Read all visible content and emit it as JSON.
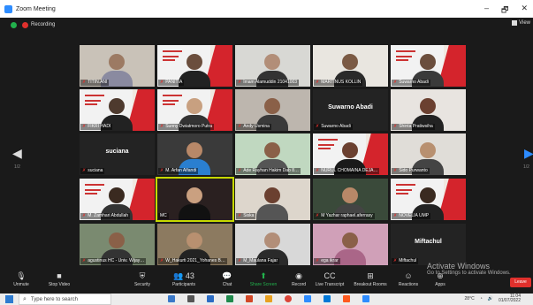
{
  "window": {
    "title": "Zoom Meeting",
    "controls": [
      "–",
      "🗗",
      "✕"
    ]
  },
  "topbar": {
    "recording_label": "Recording",
    "view_label": "View"
  },
  "pager": {
    "left": "1/2",
    "right": "1/2"
  },
  "tiles": [
    {
      "name": "TITIN.ANI",
      "kind": "person",
      "bg": "#c9c2b8",
      "skin": "#9c7a63",
      "cloth": "#8a8aa0",
      "muted": true
    },
    {
      "name": "PANITIA",
      "kind": "slide-person",
      "bg": "#f0e8e0",
      "skin": "#6b4e3d",
      "cloth": "#222",
      "muted": true
    },
    {
      "name": "Imam Alamuddin 21041003",
      "kind": "person",
      "bg": "#d8d8d4",
      "skin": "#b28e78",
      "cloth": "#333",
      "muted": true
    },
    {
      "name": "MARTINUS KOLLIN",
      "kind": "person",
      "bg": "#e9e6e0",
      "skin": "#7b5a44",
      "cloth": "#2a2a2a",
      "muted": true
    },
    {
      "name": "Suwarno Abadi",
      "kind": "slide-person",
      "bg": "#f0e8e0",
      "skin": "#6b4e3d",
      "cloth": "#3a3a3a",
      "muted": true
    },
    {
      "name": "FIKRI HADI",
      "kind": "slide-person",
      "bg": "#f0e8e0",
      "skin": "#4e3a2e",
      "cloth": "#222",
      "muted": true
    },
    {
      "name": "Sunny Dwiatmoro Putra",
      "kind": "slide-person",
      "bg": "#f0e8e0",
      "skin": "#c8a080",
      "cloth": "#333",
      "muted": true
    },
    {
      "name": "Andy Usmina",
      "kind": "person",
      "bg": "#bdb6ae",
      "skin": "#8a6048",
      "cloth": "#3a3a3a",
      "muted": true
    },
    {
      "name": "Suwarno Abadi",
      "kind": "name",
      "big": "Suwarno Abadi",
      "bg": "#232323",
      "muted": true
    },
    {
      "name": "Shinta Pratiwsiha",
      "kind": "person",
      "bg": "#e8e4e0",
      "skin": "#6b4030",
      "cloth": "#222",
      "muted": true
    },
    {
      "name": "suciana",
      "kind": "name",
      "big": "suciana",
      "bg": "#232323",
      "muted": true
    },
    {
      "name": "M. Arfan Alfandi",
      "kind": "person",
      "bg": "#3a3a3a",
      "skin": "#b88868",
      "cloth": "#2a7fd0",
      "muted": true
    },
    {
      "name": "Ade Rayhan Hakim Dab 8…",
      "kind": "person",
      "bg": "#c0d8c0",
      "skin": "#8a6048",
      "cloth": "#555",
      "muted": true
    },
    {
      "name": "NURUL CHOMAINA DEJA…",
      "kind": "slide-person",
      "bg": "#f0e8e0",
      "skin": "#6b4030",
      "cloth": "#1a1a1a",
      "muted": true
    },
    {
      "name": "Sido Purwanto",
      "kind": "person",
      "bg": "#e0ddd8",
      "skin": "#b89070",
      "cloth": "#444",
      "muted": true
    },
    {
      "name": "M. Zamhari Abdullah",
      "kind": "slide-person",
      "bg": "#f0e8e0",
      "skin": "#3a2a20",
      "cloth": "#333",
      "muted": true
    },
    {
      "name": "MC",
      "kind": "person",
      "bg": "#2a2020",
      "skin": "#caa080",
      "cloth": "#111",
      "muted": false,
      "speaking": true
    },
    {
      "name": "Siska",
      "kind": "person",
      "bg": "#ddd6cc",
      "skin": "#6b4030",
      "cloth": "#555",
      "muted": true
    },
    {
      "name": "M Yazhar raphael.aferrasy",
      "kind": "person",
      "bg": "#3a4a3a",
      "skin": "#b88868",
      "cloth": "#444",
      "muted": true
    },
    {
      "name": "NOVELIA UMP",
      "kind": "slide-person",
      "bg": "#f0e8e0",
      "skin": "#3a2a20",
      "cloth": "#222",
      "muted": true
    },
    {
      "name": "agustinus HC - Univ. Wijay…",
      "kind": "person",
      "bg": "#7a8a70",
      "skin": "#8a6048",
      "cloth": "#333",
      "muted": true
    },
    {
      "name": "W_Hakurti 2021_Yohanes B…",
      "kind": "person",
      "bg": "#8c7a60",
      "skin": "#b89070",
      "cloth": "#222",
      "muted": true
    },
    {
      "name": "M_Maulana Fajar",
      "kind": "person",
      "bg": "#d8d8d8",
      "skin": "#b28e78",
      "cloth": "#2a2a2a",
      "muted": true
    },
    {
      "name": "ega ikrar",
      "kind": "person",
      "bg": "#d0a0b8",
      "skin": "#8a6048",
      "cloth": "#aa6688",
      "muted": true
    },
    {
      "name": "Miftachul",
      "kind": "name",
      "big": "Miftachul",
      "bg": "#232323",
      "muted": true
    }
  ],
  "toolbar": {
    "items": [
      {
        "label": "Unmute",
        "icon": "microphone-icon",
        "glyph": "🎙"
      },
      {
        "label": "Stop Video",
        "icon": "video-camera-icon",
        "glyph": "■"
      },
      {
        "label": "Security",
        "icon": "shield-icon",
        "glyph": "⛨"
      },
      {
        "label": "Participants",
        "icon": "participants-icon",
        "glyph": "👥",
        "count": "43"
      },
      {
        "label": "Chat",
        "icon": "chat-icon",
        "glyph": "💬"
      },
      {
        "label": "Share Screen",
        "icon": "share-screen-icon",
        "glyph": "⬆"
      },
      {
        "label": "Record",
        "icon": "record-icon",
        "glyph": "◉"
      },
      {
        "label": "Live Transcript",
        "icon": "transcript-icon",
        "glyph": "CC"
      },
      {
        "label": "Breakout Rooms",
        "icon": "breakout-icon",
        "glyph": "⊞"
      },
      {
        "label": "Reactions",
        "icon": "reactions-icon",
        "glyph": "☺"
      },
      {
        "label": "Apps",
        "icon": "apps-icon",
        "glyph": "⊕"
      }
    ],
    "leave_label": "Leave"
  },
  "watermark": {
    "title": "Activate Windows",
    "subtitle": "Go to Settings to activate Windows."
  },
  "taskbar": {
    "search_placeholder": "Type here to search",
    "weather": "28°C",
    "time": "11:04",
    "date": "01/07/2022"
  },
  "colors": {
    "zoom_blue": "#2d8cff",
    "recording_red": "#e0302c",
    "speaker_outline": "#c6d800",
    "share_green": "#22b14c"
  }
}
